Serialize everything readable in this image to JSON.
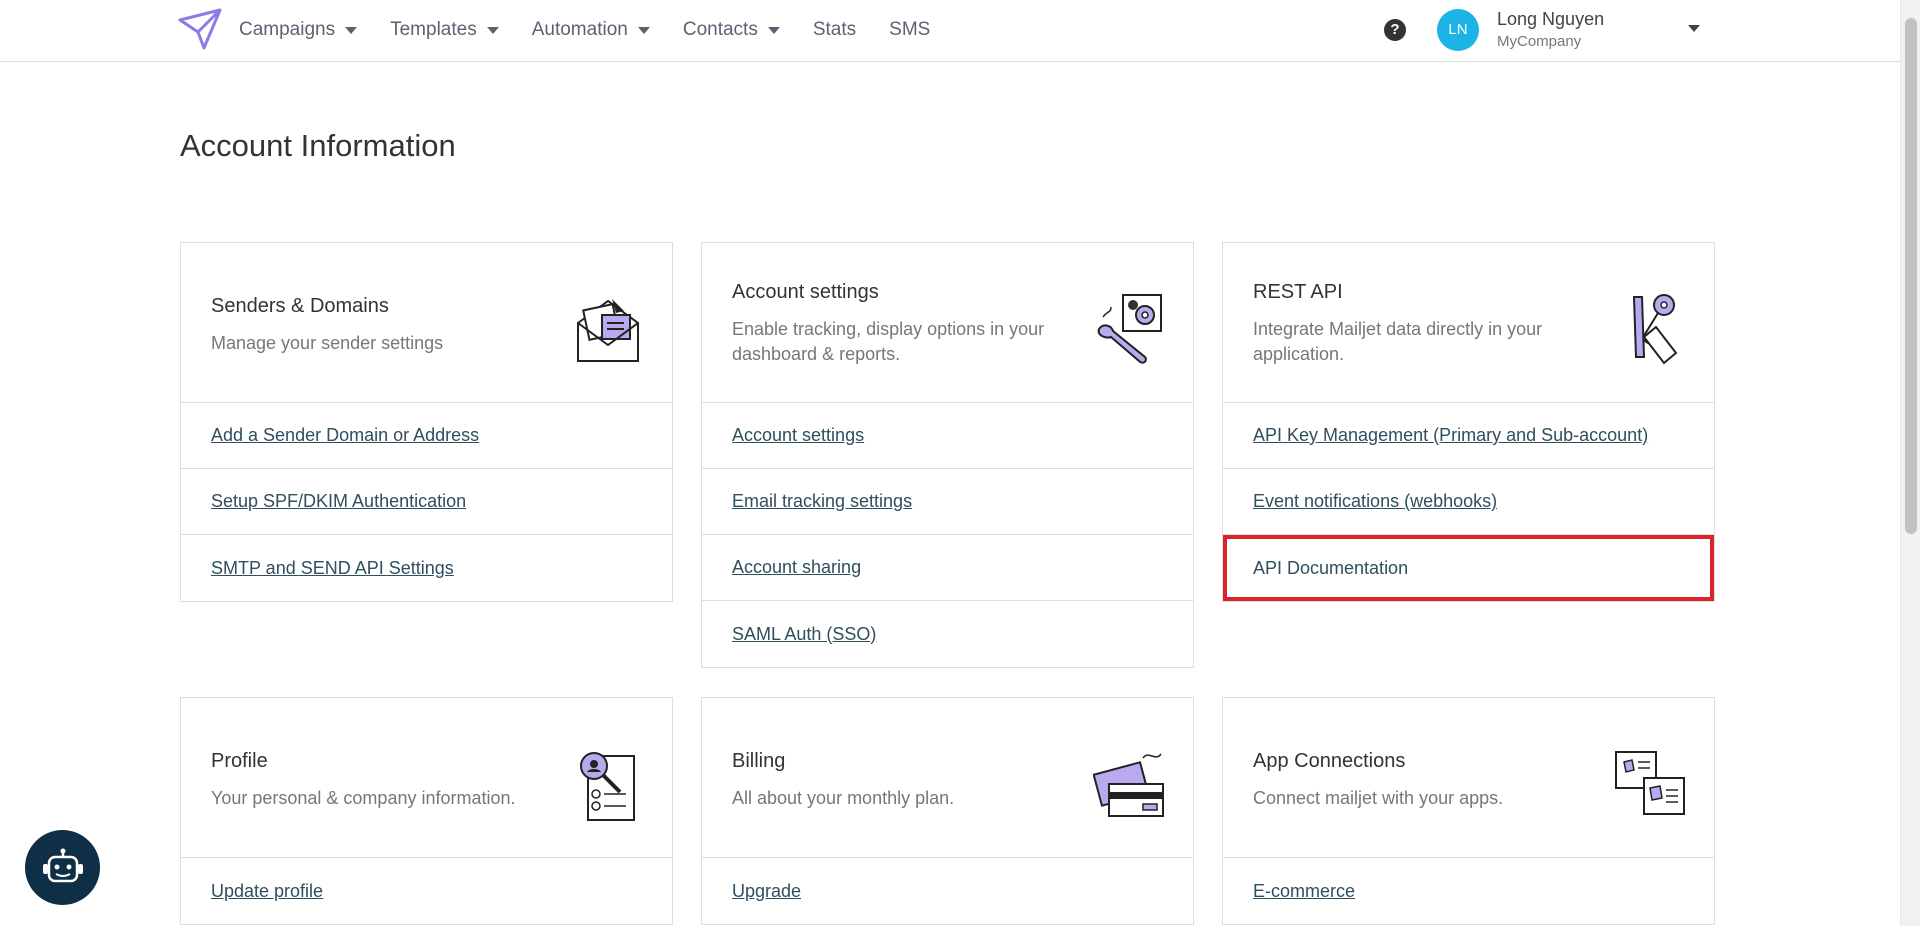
{
  "nav": {
    "items": [
      {
        "label": "Campaigns",
        "dropdown": true
      },
      {
        "label": "Templates",
        "dropdown": true
      },
      {
        "label": "Automation",
        "dropdown": true
      },
      {
        "label": "Contacts",
        "dropdown": true
      },
      {
        "label": "Stats",
        "dropdown": false
      },
      {
        "label": "SMS",
        "dropdown": false
      }
    ],
    "help": "?",
    "user": {
      "initials": "LN",
      "name": "Long Nguyen",
      "company": "MyCompany"
    }
  },
  "page": {
    "title": "Account Information"
  },
  "cards": [
    {
      "title": "Senders & Domains",
      "description": "Manage your sender settings",
      "icon": "envelope-illustration",
      "links": [
        "Add a Sender Domain or Address",
        "Setup SPF/DKIM Authentication",
        "SMTP and SEND API Settings"
      ]
    },
    {
      "title": "Account settings",
      "description": "Enable tracking, display options in your dashboard & reports.",
      "icon": "wrench-gear-illustration",
      "links": [
        "Account settings",
        "Email tracking settings",
        "Account sharing",
        "SAML Auth (SSO)"
      ]
    },
    {
      "title": "REST API",
      "description": "Integrate Mailjet data directly in your application.",
      "icon": "keys-illustration",
      "links": [
        "API Key Management (Primary and Sub-account)",
        "Event notifications (webhooks)",
        "API Documentation"
      ]
    },
    {
      "title": "Profile",
      "description": "Your personal & company information.",
      "icon": "profile-search-illustration",
      "links": [
        "Update profile"
      ]
    },
    {
      "title": "Billing",
      "description": "All about your monthly plan.",
      "icon": "credit-card-illustration",
      "links": [
        "Upgrade"
      ]
    },
    {
      "title": "App Connections",
      "description": "Connect mailjet with your apps.",
      "icon": "app-cards-illustration",
      "links": [
        "E-commerce"
      ]
    }
  ],
  "colors": {
    "accent": "#8c7ae6",
    "avatar": "#1cb4e4",
    "highlight": "#d9232d",
    "chatbot": "#0e2f45"
  }
}
